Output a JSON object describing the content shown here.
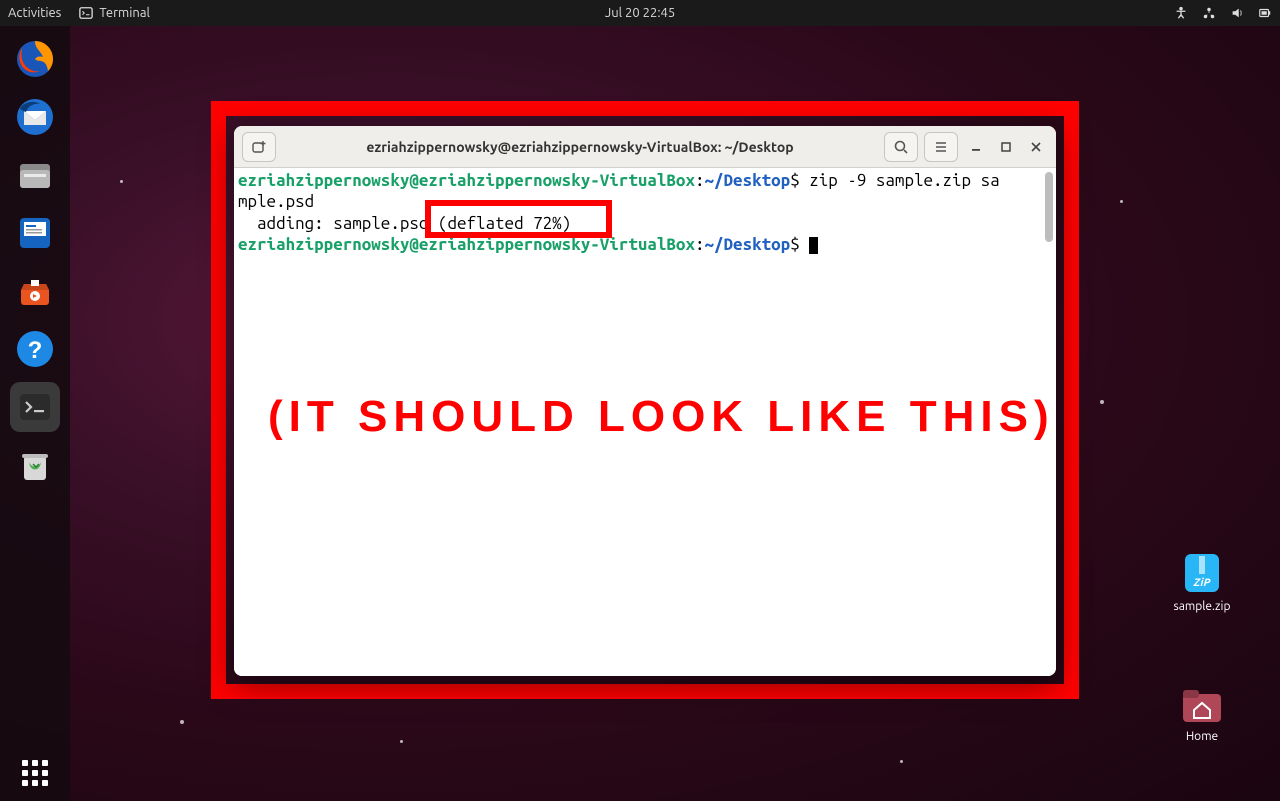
{
  "topbar": {
    "activities": "Activities",
    "app_name": "Terminal",
    "datetime": "Jul 20  22:45"
  },
  "dock": {
    "items": [
      {
        "name": "firefox-icon"
      },
      {
        "name": "thunderbird-icon"
      },
      {
        "name": "files-icon"
      },
      {
        "name": "writer-icon"
      },
      {
        "name": "software-icon"
      },
      {
        "name": "help-icon"
      },
      {
        "name": "terminal-icon"
      },
      {
        "name": "trash-icon"
      }
    ]
  },
  "desktop": {
    "zip_file": "sample.zip",
    "home": "Home"
  },
  "terminal": {
    "title": "ezriahzippernowsky@ezriahzippernowsky-VirtualBox: ~/Desktop",
    "prompt_user": "ezriahzippernowsky@ezriahzippernowsky-VirtualBox",
    "prompt_colon": ":",
    "prompt_path": "~/Desktop",
    "prompt_sym": "$",
    "cmd1_part1": " zip -9 sample.zip sa",
    "cmd1_wrap": "mple.psd",
    "output_adding": "  adding: sample.psd ",
    "output_deflated": "(deflated 72%)",
    "cmd2_text": " "
  },
  "annotation": {
    "caption": "(IT SHOULD LOOK LIKE THIS)"
  }
}
